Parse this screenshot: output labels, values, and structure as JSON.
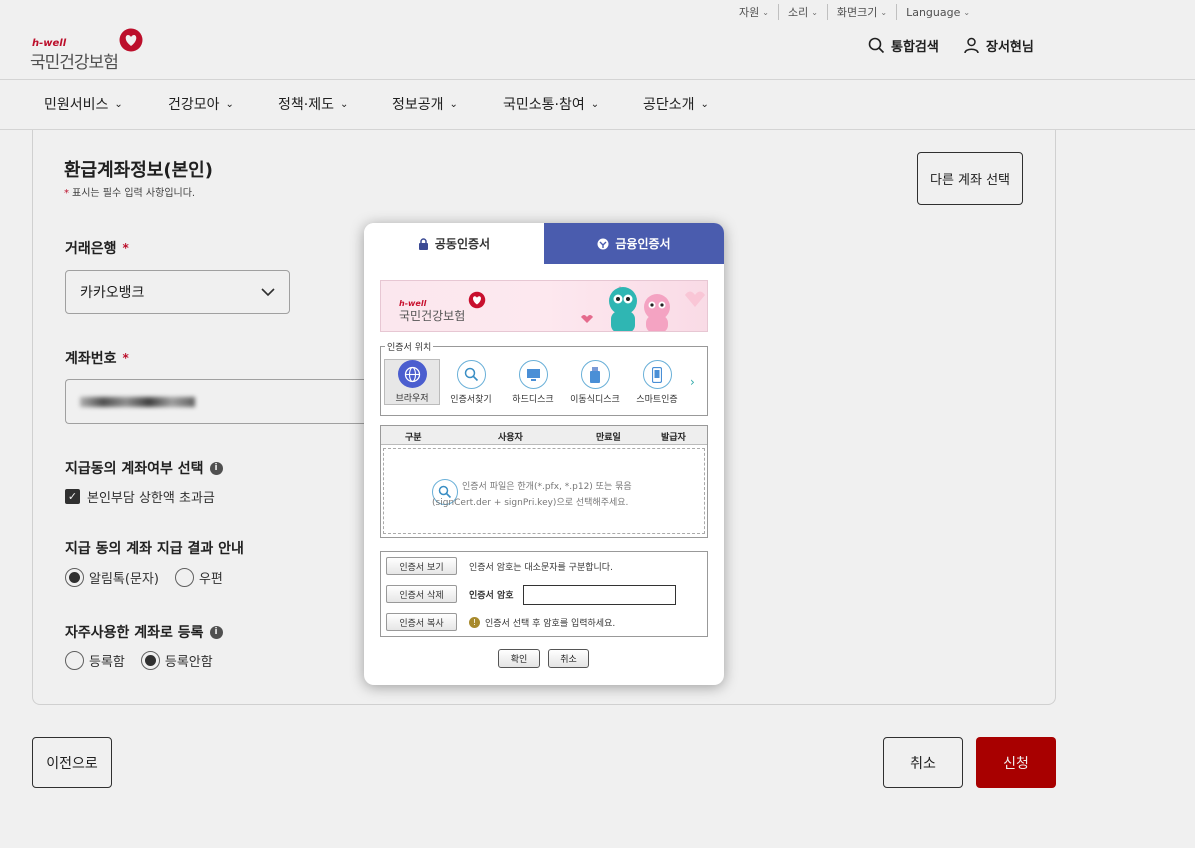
{
  "util_bar": {
    "items": [
      "자원",
      "소리",
      "화면크기",
      "Language"
    ]
  },
  "header": {
    "logo_small": "h-well",
    "logo_name": "국민건강보험",
    "search_label": "통합검색",
    "user_label": "장서현님"
  },
  "nav": {
    "items": [
      "민원서비스",
      "건강모아",
      "정책·제도",
      "정보공개",
      "국민소통·참여",
      "공단소개"
    ]
  },
  "section": {
    "title": "환급계좌정보(본인)",
    "note": "표시는 필수 입력 사항입니다.",
    "required_mark": "*",
    "other_account_button": "다른 계좌 선택"
  },
  "bank": {
    "label": "거래은행",
    "required": "*",
    "value": "카카오뱅크"
  },
  "account": {
    "label": "계좌번호",
    "required": "*"
  },
  "payment_choice": {
    "label": "지급동의 계좌여부 선택",
    "info": "i",
    "checkbox_label": "본인부담 상한액 초과금",
    "checked": true
  },
  "notice": {
    "label": "지급 동의 계좌 지급 결과 안내",
    "options": [
      "알림톡(문자)",
      "우편"
    ],
    "selected": "알림톡(문자)"
  },
  "register": {
    "label": "자주사용한 계좌로 등록",
    "info": "i",
    "options": [
      "등록함",
      "등록안함"
    ],
    "selected": "등록안함"
  },
  "footer": {
    "prev": "이전으로",
    "cancel": "취소",
    "apply": "신청"
  },
  "modal": {
    "tabs": [
      "공동인증서",
      "금융인증서"
    ],
    "active_tab": "공동인증서",
    "tab_colors": {
      "inactive_bg": "#4a5cae"
    },
    "banner_small": "h-well",
    "banner_name": "국민건강보험",
    "location_legend": "인증서 위치",
    "locations": [
      "브라우저",
      "인증서찾기",
      "하드디스크",
      "이동식디스크",
      "스마트인증"
    ],
    "selected_location": "브라우저",
    "table_headers": [
      "구분",
      "사용자",
      "만료일",
      "발급자"
    ],
    "empty_msg_line1": "인증서 파일은 한개(*.pfx, *.p12) 또는 묶음",
    "empty_msg_line2": "(signCert.der + signPri.key)으로 선택해주세요.",
    "btn_view": "인증서 보기",
    "btn_delete": "인증서 삭제",
    "btn_copy": "인증서 복사",
    "case_note": "인증서 암호는 대소문자를 구분합니다.",
    "pw_label": "인증서 암호",
    "pw_hint": "인증서 선택 후 암호를 입력하세요.",
    "warn_mark": "!",
    "ok": "확인",
    "cancel": "취소"
  },
  "colors": {
    "brand_red": "#c8102e",
    "apply_button": "#b30000",
    "modal_tab": "#4a5cae"
  }
}
